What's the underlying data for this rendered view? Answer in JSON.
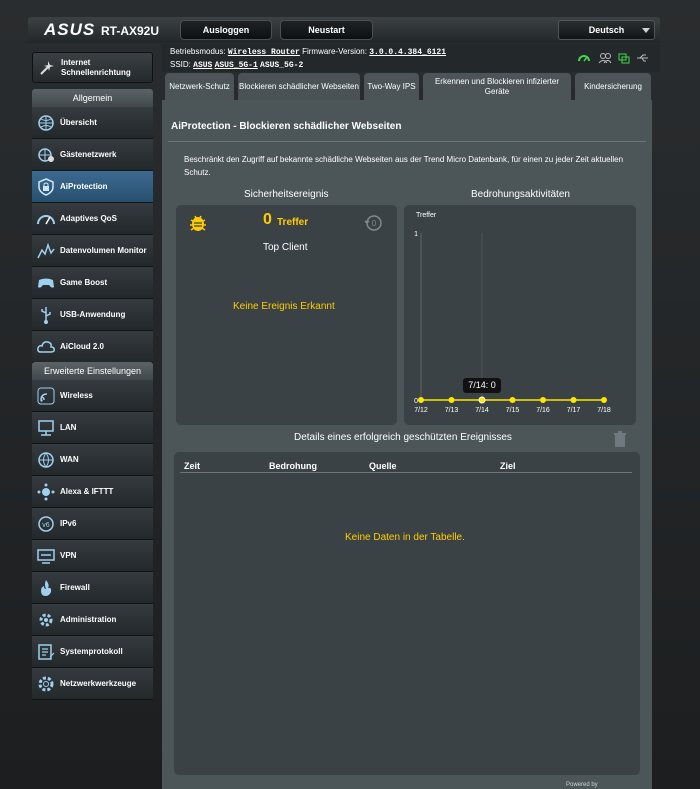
{
  "header": {
    "brand": "ASUS",
    "model": "RT-AX92U",
    "logout": "Ausloggen",
    "restart": "Neustart",
    "language": "Deutsch"
  },
  "info": {
    "mode_label": "Betriebsmodus:",
    "mode_value": "Wireless Router",
    "fw_label": "Firmware-Version:",
    "fw_value": "3.0.0.4.384_6121",
    "ssid_label": "SSID:",
    "ssid": [
      "ASUS",
      "ASUS_5G-1",
      "ASUS_5G-2"
    ]
  },
  "sidebar": {
    "qis": "Internet Schnellenrichtung",
    "general_header": "Allgemein",
    "general": [
      {
        "label": "Übersicht",
        "icon": "globe-map-icon"
      },
      {
        "label": "Gästenetzwerk",
        "icon": "guest-globe-icon"
      },
      {
        "label": "AiProtection",
        "icon": "lock-shield-icon"
      },
      {
        "label": "Adaptives QoS",
        "icon": "speedometer-icon"
      },
      {
        "label": "Datenvolumen Monitor",
        "icon": "traffic-chart-icon"
      },
      {
        "label": "Game Boost",
        "icon": "gamepad-icon"
      },
      {
        "label": "USB-Anwendung",
        "icon": "usb-icon"
      },
      {
        "label": "AiCloud 2.0",
        "icon": "cloud-icon"
      }
    ],
    "advanced_header": "Erweiterte Einstellungen",
    "advanced": [
      {
        "label": "Wireless",
        "icon": "wifi-icon"
      },
      {
        "label": "LAN",
        "icon": "lan-icon"
      },
      {
        "label": "WAN",
        "icon": "wan-globe-icon"
      },
      {
        "label": "Alexa & IFTTT",
        "icon": "alexa-icon"
      },
      {
        "label": "IPv6",
        "icon": "ipv6-icon"
      },
      {
        "label": "VPN",
        "icon": "vpn-icon"
      },
      {
        "label": "Firewall",
        "icon": "firewall-icon"
      },
      {
        "label": "Administration",
        "icon": "admin-gear-icon"
      },
      {
        "label": "Systemprotokoll",
        "icon": "syslog-icon"
      },
      {
        "label": "Netzwerkwerkzeuge",
        "icon": "network-tools-icon"
      }
    ]
  },
  "tabs": [
    {
      "label": "Netzwerk-Schutz"
    },
    {
      "label": "Blockieren schädlicher Webseiten"
    },
    {
      "label": "Two-Way IPS"
    },
    {
      "label": "Erkennen und Blockieren infizierter Geräte"
    },
    {
      "label": "Kindersicherung"
    }
  ],
  "page": {
    "title": "AiProtection - Blockieren schädlicher Webseiten",
    "description": "Beschränkt den Zugriff auf bekannte schädliche Webseiten aus der Trend Micro Datenbank, für einen zu jeder Zeit aktuellen Schutz.",
    "security_title": "Sicherheitsereignis",
    "threat_title": "Bedrohungsaktivitäten",
    "hits_count": "0",
    "hits_label": "Treffer",
    "top_client": "Top Client",
    "no_event": "Keine Ereignis Erkannt",
    "details_title": "Details eines erfolgreich geschützten Ereignisses",
    "columns": [
      "Zeit",
      "Bedrohung",
      "Quelle",
      "Ziel"
    ],
    "no_data": "Keine Daten in der Tabelle.",
    "footer": "Powered by"
  },
  "chart_data": {
    "type": "line",
    "ylabel": "Treffer",
    "y_ticks": [
      "1",
      "0"
    ],
    "ylim": [
      0,
      1
    ],
    "categories": [
      "7/12",
      "7/13",
      "7/14",
      "7/15",
      "7/16",
      "7/17",
      "7/18"
    ],
    "series": [
      {
        "values": [
          0,
          0,
          0,
          0,
          0,
          0,
          0
        ]
      }
    ],
    "tooltip": "7/14: 0",
    "line_color": "#ffe600"
  }
}
